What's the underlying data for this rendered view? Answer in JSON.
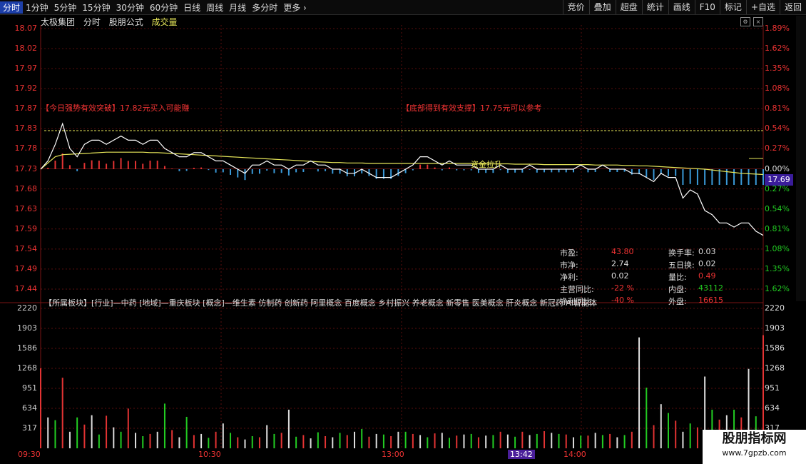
{
  "toolbar": {
    "timeframes": [
      "分时",
      "1分钟",
      "5分钟",
      "15分钟",
      "30分钟",
      "60分钟",
      "日线",
      "周线",
      "月线",
      "多分时",
      "更多"
    ],
    "right_buttons": [
      "竞价",
      "叠加",
      "超盘",
      "统计",
      "画线",
      "F10",
      "标记",
      "+自选",
      "返回"
    ]
  },
  "header": {
    "stock_name": "太极集团",
    "mode": "分时",
    "formula": "股朋公式",
    "indicator": "成交量"
  },
  "price_axis": {
    "left": [
      "18.07",
      "18.02",
      "17.97",
      "17.92",
      "17.87",
      "17.83",
      "17.78",
      "17.73",
      "17.68",
      "17.63",
      "17.59",
      "17.54",
      "17.49",
      "17.44"
    ],
    "right": [
      "1.89%",
      "1.62%",
      "1.35%",
      "1.08%",
      "0.81%",
      "0.54%",
      "0.27%",
      "0.00%",
      "0.27%",
      "0.54%",
      "0.81%",
      "1.08%",
      "1.35%",
      "1.62%"
    ]
  },
  "volume_axis": {
    "labels": [
      "2220",
      "1903",
      "1586",
      "1268",
      "951",
      "634",
      "317"
    ]
  },
  "signals": {
    "left": "【今日强势有效突破】17.82元买入可能赚",
    "right": "【底部得到有效支撑】17.75元可以参考",
    "center": "资金拉升"
  },
  "last_price": "17.69",
  "stats": {
    "rows": [
      {
        "k1": "市盈:",
        "v1": "43.80",
        "k2": "换手率:",
        "v2": "0.03"
      },
      {
        "k1": "市净:",
        "v1": "2.74",
        "k2": "五日换:",
        "v2": "0.02"
      },
      {
        "k1": "净利:",
        "v1": "0.02",
        "k2": "量比:",
        "v2": "0.49"
      },
      {
        "k1": "主营同比:",
        "v1": "-22 %",
        "k2": "内盘:",
        "v2": "43112"
      },
      {
        "k1": "净利同比:",
        "v1": "-40 %",
        "k2": "外盘:",
        "v2": "16615"
      }
    ]
  },
  "sectors_text": "【所属板块】[行业]—中药 [地域]—重庆板块 [概念]—维生素 仿制药 创新药 阿里概念 百度概念 乡村振兴 养老概念 新零售 医美概念 肝炎概念 新冠药 AI智能体",
  "time_axis": {
    "labels": [
      "09:30",
      "10:30",
      "13:00",
      "13:42",
      "14:00"
    ],
    "cursor": "13:42"
  },
  "watermark": {
    "line1": "股朋指标网",
    "line2": "www.7gpzb.com"
  },
  "colors": {
    "up": "#e33333",
    "down": "#22cc22",
    "price_line": "#ffffff",
    "avg_line": "#e8e85a",
    "grid": "#6b1010"
  },
  "chart_data": {
    "type": "line",
    "title": "",
    "ylim": [
      17.44,
      18.07
    ],
    "base_price": 17.73,
    "series": [
      {
        "values": [
          17.73,
          17.75,
          17.79,
          17.84,
          17.78,
          17.76,
          17.79,
          17.8,
          17.8,
          17.79,
          17.8,
          17.81,
          17.8,
          17.8,
          17.79,
          17.8,
          17.8,
          17.78,
          17.77,
          17.76,
          17.76,
          17.77,
          17.77,
          17.76,
          17.75,
          17.75,
          17.74,
          17.73,
          17.72,
          17.74,
          17.74,
          17.75,
          17.74,
          17.74,
          17.73,
          17.74,
          17.74,
          17.75,
          17.74,
          17.74,
          17.73,
          17.73,
          17.72,
          17.72,
          17.73,
          17.72,
          17.71,
          17.71,
          17.71,
          17.72,
          17.73,
          17.74,
          17.76,
          17.76,
          17.75,
          17.74,
          17.75,
          17.74,
          17.74,
          17.74,
          17.73,
          17.73,
          17.73,
          17.74,
          17.73,
          17.73,
          17.73,
          17.74,
          17.73,
          17.73,
          17.73,
          17.73,
          17.73,
          17.73,
          17.74,
          17.73,
          17.73,
          17.74,
          17.73,
          17.73,
          17.73,
          17.72,
          17.72,
          17.71,
          17.7,
          17.72,
          17.71,
          17.71,
          17.66,
          17.68,
          17.67,
          17.63,
          17.62,
          17.6,
          17.6,
          17.59,
          17.6,
          17.6,
          17.58,
          17.57
        ]
      },
      {
        "values": [
          17.73,
          17.745,
          17.76,
          17.765,
          17.766,
          17.767,
          17.768,
          17.769,
          17.77,
          17.771,
          17.771,
          17.771,
          17.771,
          17.771,
          17.771,
          17.77,
          17.77,
          17.769,
          17.768,
          17.767,
          17.766,
          17.765,
          17.764,
          17.763,
          17.762,
          17.761,
          17.76,
          17.759,
          17.758,
          17.757,
          17.756,
          17.755,
          17.754,
          17.753,
          17.752,
          17.751,
          17.75,
          17.749,
          17.748,
          17.747,
          17.746,
          17.746,
          17.745,
          17.745,
          17.745,
          17.744,
          17.744,
          17.744,
          17.744,
          17.744,
          17.744,
          17.744,
          17.744,
          17.744,
          17.744,
          17.744,
          17.744,
          17.744,
          17.744,
          17.744,
          17.743,
          17.743,
          17.743,
          17.743,
          17.743,
          17.742,
          17.742,
          17.742,
          17.742,
          17.741,
          17.741,
          17.741,
          17.741,
          17.741,
          17.741,
          17.741,
          17.74,
          17.74,
          17.74,
          17.74,
          17.739,
          17.739,
          17.738,
          17.738,
          17.737,
          17.736,
          17.735,
          17.734,
          17.733,
          17.732,
          17.731,
          17.73,
          17.728,
          17.726,
          17.724,
          17.722,
          17.72,
          17.719,
          17.718,
          17.717
        ]
      }
    ],
    "volume_values": [
      1450,
      560,
      510,
      1280,
      300,
      560,
      430,
      600,
      250,
      590,
      380,
      300,
      720,
      280,
      220,
      260,
      300,
      810,
      330,
      200,
      570,
      240,
      260,
      190,
      300,
      450,
      280,
      200,
      160,
      220,
      200,
      420,
      260,
      280,
      700,
      210,
      240,
      180,
      290,
      220,
      200,
      280,
      240,
      300,
      350,
      210,
      260,
      250,
      220,
      300,
      300,
      260,
      240,
      200,
      270,
      280,
      190,
      230,
      250,
      260,
      200,
      230,
      240,
      300,
      250,
      210,
      300,
      240,
      260,
      310,
      280,
      260,
      250,
      200,
      230,
      230,
      280,
      240,
      260,
      200,
      240,
      300,
      2010,
      1100,
      420,
      800,
      640,
      500,
      300,
      450,
      380,
      1300,
      700,
      520,
      600,
      700,
      560,
      1440,
      580,
      2050
    ]
  }
}
